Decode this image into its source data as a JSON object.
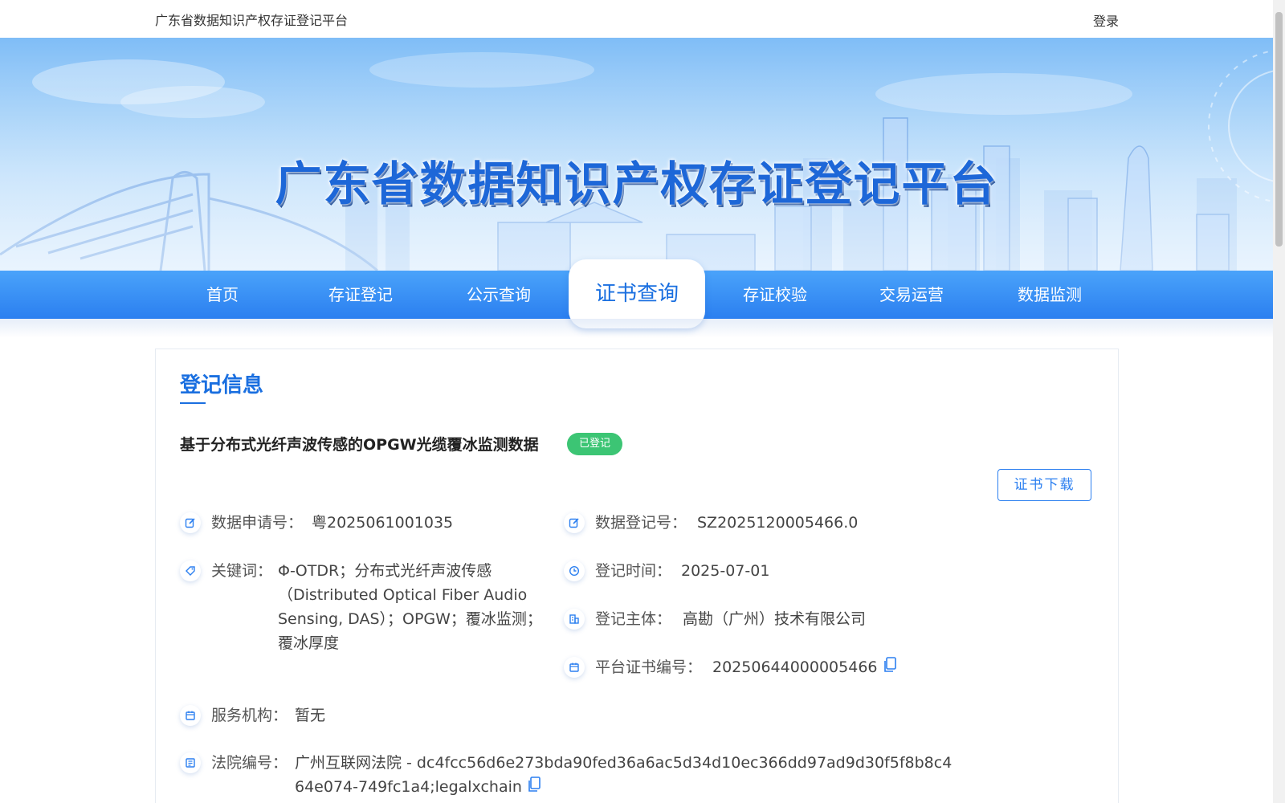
{
  "header": {
    "site_name": "广东省数据知识产权存证登记平台",
    "login_label": "登录"
  },
  "banner": {
    "title": "广东省数据知识产权存证登记平台"
  },
  "nav": {
    "items": [
      {
        "label": "首页",
        "active": false
      },
      {
        "label": "存证登记",
        "active": false
      },
      {
        "label": "公示查询",
        "active": false
      },
      {
        "label": "证书查询",
        "active": true
      },
      {
        "label": "存证校验",
        "active": false
      },
      {
        "label": "交易运营",
        "active": false
      },
      {
        "label": "数据监测",
        "active": false
      }
    ]
  },
  "section": {
    "title": "登记信息"
  },
  "record": {
    "title": "基于分布式光纤声波传感的OPGW光缆覆冰监测数据",
    "status": "已登记",
    "download_label": "证书下载",
    "fields": {
      "application_no": {
        "label": "数据申请号：",
        "value": "粤2025061001035",
        "icon": "edit-icon"
      },
      "registration_no": {
        "label": "数据登记号：",
        "value": "SZ2025120005466.0",
        "icon": "edit-icon"
      },
      "keywords": {
        "label": "关键词：",
        "value": "Φ-OTDR；分布式光纤声波传感（Distributed Optical Fiber Audio Sensing, DAS）；OPGW；覆冰监测；覆冰厚度",
        "icon": "tag-icon"
      },
      "registration_time": {
        "label": "登记时间：",
        "value": "2025-07-01",
        "icon": "clock-icon"
      },
      "registrant": {
        "label": "登记主体：",
        "value": "高勘（广州）技术有限公司",
        "icon": "building-icon"
      },
      "certificate_no": {
        "label": "平台证书编号：",
        "value": "20250644000005466",
        "icon": "calendar-icon"
      },
      "service_org": {
        "label": "服务机构：",
        "value": "暂无",
        "icon": "calendar-icon"
      },
      "court_no": {
        "label": "法院编号：",
        "value": "广州互联网法院 - dc4fcc56d6e273bda90fed36a6ac5d34d10ec366dd97ad9d30f5f8b8c464e074-749fc1a4;legalxchain",
        "icon": "document-icon"
      }
    }
  },
  "colors": {
    "primary": "#1a6fe0",
    "nav_blue": "#2b7ff0",
    "badge_green": "#3cc574"
  }
}
